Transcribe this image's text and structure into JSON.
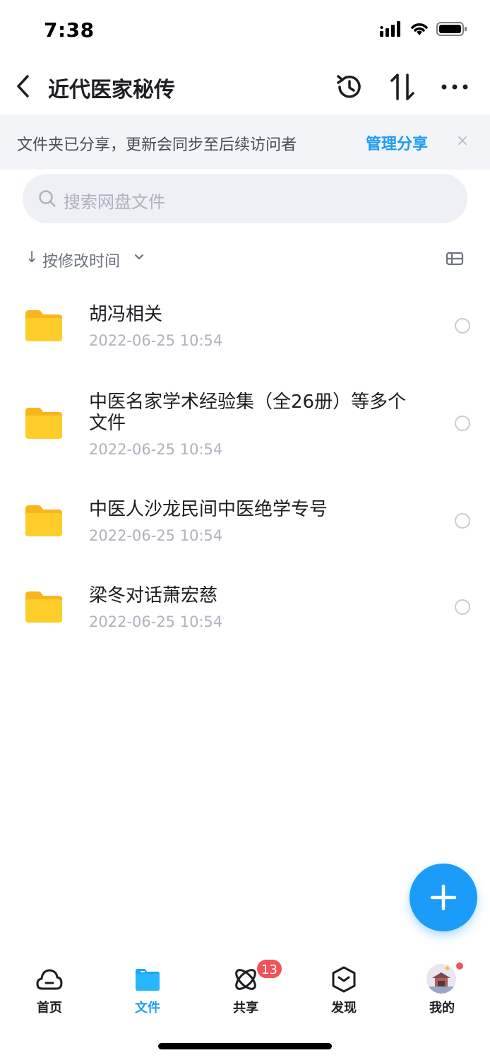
{
  "status_bar": {
    "time": "7:38"
  },
  "nav": {
    "title": "近代医家秘传"
  },
  "share_banner": {
    "text": "文件夹已分享，更新会同步至后续访问者",
    "manage_label": "管理分享",
    "close_label": "×"
  },
  "search": {
    "placeholder": "搜索网盘文件"
  },
  "sort": {
    "label": "按修改时间"
  },
  "files": [
    {
      "name": "胡冯相关",
      "date": "2022-06-25 10:54"
    },
    {
      "name": "中医名家学术经验集（全26册）等多个文件",
      "date": "2022-06-25 10:54"
    },
    {
      "name": "中医人沙龙民间中医绝学专号",
      "date": "2022-06-25 10:54"
    },
    {
      "name": "梁冬对话萧宏慈",
      "date": "2022-06-25 10:54"
    }
  ],
  "tabs": [
    {
      "label": "首页",
      "icon": "cloud-icon"
    },
    {
      "label": "文件",
      "icon": "folder-icon"
    },
    {
      "label": "共享",
      "icon": "share-orbit-icon"
    },
    {
      "label": "发现",
      "icon": "discover-box-icon"
    },
    {
      "label": "我的",
      "icon": "avatar"
    }
  ],
  "share_badge": "13",
  "colors": {
    "accent": "#1c9bf4",
    "folder": "#ffc107",
    "badge": "#f0535b"
  }
}
